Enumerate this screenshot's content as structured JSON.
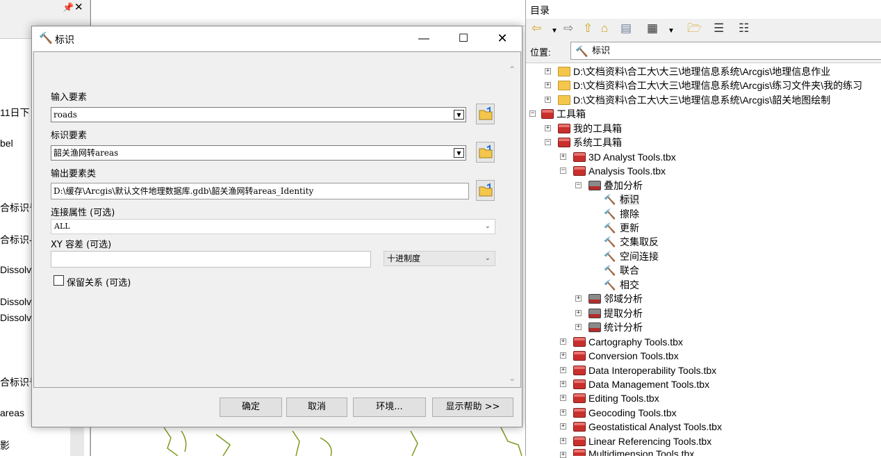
{
  "left_panel": {
    "items": [
      "11日下",
      "bel",
      "合标识号",
      "合标识-",
      "Dissolve",
      "Dissolve",
      "Dissolve",
      "合标识号",
      "areas",
      "影"
    ]
  },
  "dialog": {
    "title": "标识",
    "fields": {
      "input_label": "输入要素",
      "input_value": "roads",
      "identity_label": "标识要素",
      "identity_value": "韶关渔网转areas",
      "output_label": "输出要素类",
      "output_value": "D:\\缓存\\Arcgis\\默认文件地理数据库.gdb\\韶关渔网转areas_Identity",
      "join_label": "连接属性 (可选)",
      "join_value": "ALL",
      "xy_label": "XY 容差 (可选)",
      "xy_value": "",
      "xy_unit": "十进制度",
      "keep_rel_label": "保留关系 (可选)",
      "keep_rel_checked": false
    },
    "buttons": {
      "ok": "确定",
      "cancel": "取消",
      "env": "环境...",
      "help": "显示帮助 >>"
    }
  },
  "catalog": {
    "title": "目录",
    "location_label": "位置:",
    "location_value": "标识",
    "tree": {
      "folder1": "D:\\文档资料\\合工大\\大三\\地理信息系统\\Arcgis\\地理信息作业",
      "folder2": "D:\\文档资料\\合工大\\大三\\地理信息系统\\Arcgis\\练习文件夹\\我的练习",
      "folder3": "D:\\文档资料\\合工大\\大三\\地理信息系统\\Arcgis\\韶关地图绘制",
      "toolboxes": "工具箱",
      "my_toolboxes": "我的工具箱",
      "system_toolboxes": "系统工具箱",
      "tbx_3d": "3D Analyst Tools.tbx",
      "tbx_analysis": "Analysis Tools.tbx",
      "overlay": "叠加分析",
      "tool_identity": "标识",
      "tool_erase": "擦除",
      "tool_update": "更新",
      "tool_symdiff": "交集取反",
      "tool_spatialjoin": "空间连接",
      "tool_union": "联合",
      "tool_intersect": "相交",
      "proximity": "邻域分析",
      "extract": "提取分析",
      "statistics": "统计分析",
      "tbx_cartography": "Cartography Tools.tbx",
      "tbx_conversion": "Conversion Tools.tbx",
      "tbx_interop": "Data Interoperability Tools.tbx",
      "tbx_datamgmt": "Data Management Tools.tbx",
      "tbx_editing": "Editing Tools.tbx",
      "tbx_geocoding": "Geocoding Tools.tbx",
      "tbx_geostat": "Geostatistical Analyst Tools.tbx",
      "tbx_linear": "Linear Referencing Tools.tbx",
      "tbx_multidim": "Multidimension Tools.tbx"
    }
  }
}
